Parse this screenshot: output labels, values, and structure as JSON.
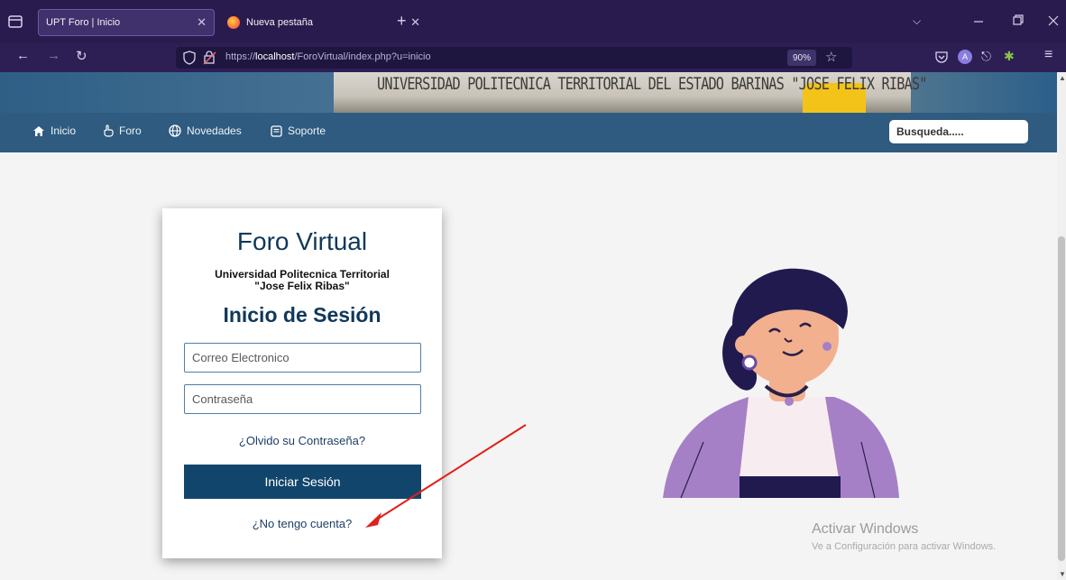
{
  "browser": {
    "tabs": [
      {
        "label": "UPT Foro | Inicio",
        "active": true
      },
      {
        "label": "Nueva pestaña",
        "active": false
      }
    ],
    "new_tab_label": "+",
    "url_prefix": "https://",
    "url_host": "localhost",
    "url_path": "/ForoVirtual/index.php?u=inicio",
    "zoom": "90%"
  },
  "banner": {
    "text": "UNIVERSIDAD POLITECNICA TERRITORIAL DEL ESTADO BARINAS \"JOSE FELIX RIBAS\""
  },
  "nav": {
    "items": [
      {
        "label": "Inicio",
        "icon": "home-icon"
      },
      {
        "label": "Foro",
        "icon": "hand-pointer-icon"
      },
      {
        "label": "Novedades",
        "icon": "globe-icon"
      },
      {
        "label": "Soporte",
        "icon": "message-icon"
      }
    ],
    "search_placeholder": "Busqueda....."
  },
  "login": {
    "title": "Foro Virtual",
    "university_line1": "Universidad Politecnica Territorial",
    "university_line2": "\"Jose Felix Ribas\"",
    "subtitle": "Inicio de Sesión",
    "email_placeholder": "Correo Electronico",
    "password_placeholder": "Contraseña",
    "forgot_link": "¿Olvido su Contraseña?",
    "submit_label": "Iniciar Sesión",
    "signup_link": "¿No tengo cuenta?"
  },
  "watermark": {
    "line1": "Activar Windows",
    "line2": "Ve a Configuración para activar Windows."
  },
  "colors": {
    "nav_bar": "#2e5b7f",
    "title_blue": "#10385a",
    "button_blue": "#12456c",
    "annotation_arrow": "#e0201b"
  }
}
